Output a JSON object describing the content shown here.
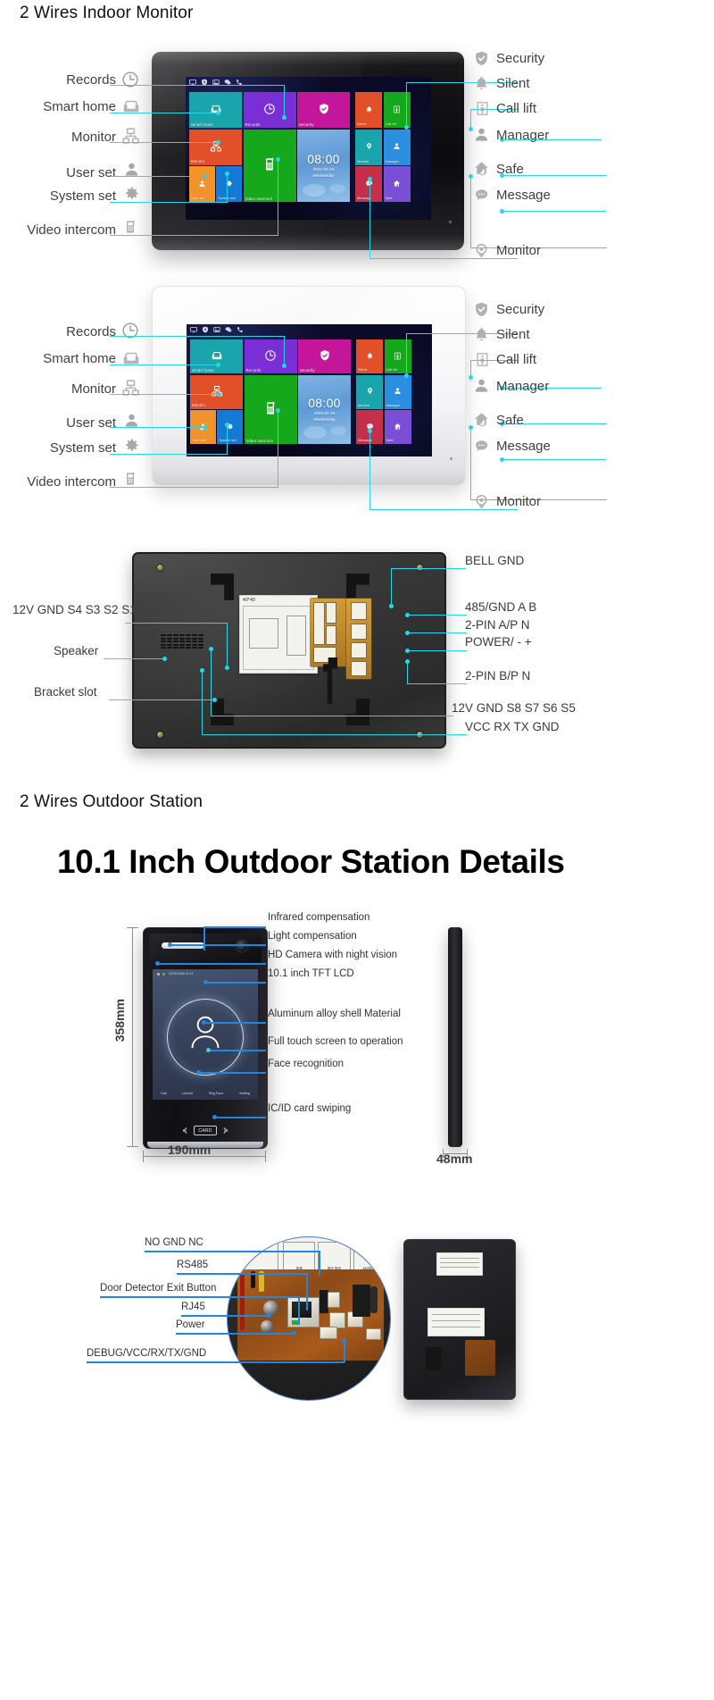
{
  "sections": {
    "indoor_title": "2 Wires Indoor Monitor",
    "outdoor_title": "2 Wires Outdoor Station",
    "outdoor_big_title": "10.1 Inch Outdoor Station Details"
  },
  "monitor_ui": {
    "status_icons": [
      "monitor-icon",
      "shield-icon",
      "picture-icon",
      "message-icon",
      "phone-icon"
    ],
    "tiles": [
      {
        "name": "Smart home",
        "icon": "sofa-icon",
        "color": "#1aa5ac"
      },
      {
        "name": "Records",
        "icon": "clock-icon",
        "color": "#7a2fd6"
      },
      {
        "name": "Security",
        "icon": "shield-check-icon",
        "color": "#c4169b"
      },
      {
        "name": "Monitor",
        "icon": "network-icon",
        "color": "#e2502a"
      },
      {
        "name": "Video intercom",
        "icon": "intercom-icon",
        "color": "#16a81c"
      },
      {
        "name": "User set",
        "icon": "user-icon",
        "color": "#f0932b"
      },
      {
        "name": "System set",
        "icon": "gear-icon",
        "color": "#1579d6"
      }
    ],
    "side_tiles": [
      {
        "name": "Silent",
        "icon": "bell-icon",
        "color": "#e2502a"
      },
      {
        "name": "Call lift",
        "icon": "elevator-icon",
        "color": "#16a81c"
      },
      {
        "name": "Monitor",
        "icon": "camera-icon",
        "color": "#1aa5ac"
      },
      {
        "name": "Manager",
        "icon": "manager-icon",
        "color": "#2a8fe0"
      },
      {
        "name": "Message",
        "icon": "message-dots-icon",
        "color": "#c4304a"
      },
      {
        "name": "Safe",
        "icon": "home-touch-icon",
        "color": "#7a4fd6"
      }
    ],
    "clock": {
      "time": "08:00",
      "date": "2023-02-15",
      "weekday": "Wednesday"
    }
  },
  "indoor_labels_left": [
    {
      "text": "Records",
      "icon": "clock-icon"
    },
    {
      "text": "Smart home",
      "icon": "sofa-icon"
    },
    {
      "text": "Monitor",
      "icon": "network-icon"
    },
    {
      "text": "User set",
      "icon": "user-icon"
    },
    {
      "text": "System set",
      "icon": "gear-icon"
    },
    {
      "text": "Video intercom",
      "icon": "intercom-icon"
    }
  ],
  "indoor_labels_right": [
    {
      "text": "Security",
      "icon": "shield-check-icon"
    },
    {
      "text": "Silent",
      "icon": "bell-icon"
    },
    {
      "text": "Call lift",
      "icon": "elevator-icon"
    },
    {
      "text": "Manager",
      "icon": "manager-icon"
    },
    {
      "text": "Safe",
      "icon": "home-touch-icon"
    },
    {
      "text": "Message",
      "icon": "message-dots-icon"
    },
    {
      "text": "Monitor",
      "icon": "camera-icon"
    }
  ],
  "back_view": {
    "left_labels": [
      "12V GND S4 S3 S2 S1",
      "Speaker",
      "Bracket slot"
    ],
    "right_labels": [
      "BELL GND",
      "485/GND A B",
      "2-PIN A/P N",
      "POWER/ - +",
      "2-PIN B/P N",
      "12V GND S8 S7 S6 S5",
      "VCC  RX TX GND"
    ],
    "sticker_title": "40*40"
  },
  "outdoor_station": {
    "labels_right": [
      "Infrared compensation",
      "Light compensation",
      "HD Camera with night vision",
      "10.1 inch TFT LCD",
      "Aluminum alloy shell Material",
      "Full touch screen to operation",
      "Face recognition",
      "IC/ID card swiping"
    ],
    "dimensions": {
      "height": "358mm",
      "width": "190mm",
      "depth": "48mm"
    },
    "screen": {
      "timestamp": "2023/12/06 11:11",
      "nav": [
        "Call",
        "Unlock",
        "Reg Face",
        "Setting"
      ],
      "card_text": "CARD"
    }
  },
  "pcb_detail": {
    "labels": [
      "NO GND NC",
      "RS485",
      "Door Detector Exit Button",
      "RJ45",
      "Power",
      "DEBUG/VCC/RX/TX/GND"
    ],
    "paper_cells": [
      "电源",
      "常开 常闭",
      "485接口"
    ]
  },
  "colors": {
    "leader_cyan": "#29d6e8",
    "leader_blue": "#2186e0",
    "text": "#3a3a3a"
  }
}
